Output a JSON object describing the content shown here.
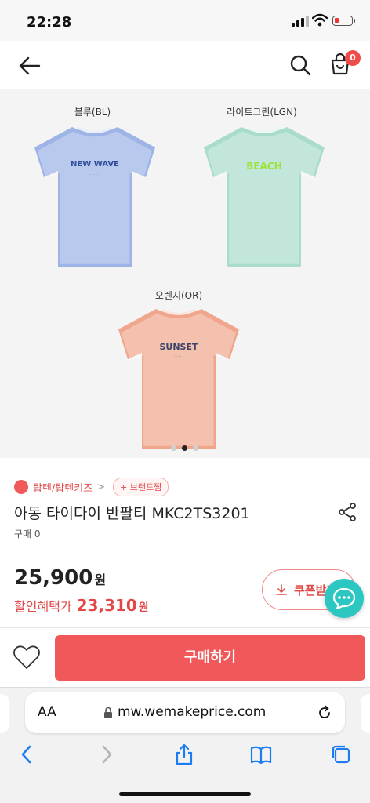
{
  "status_bar": {
    "time": "22:28",
    "signal_icon": "cellular-signal-icon",
    "wifi_icon": "wifi-icon",
    "battery_icon": "battery-low-icon",
    "battery_level": 0.15
  },
  "header": {
    "back_icon": "arrow-left-icon",
    "search_icon": "search-icon",
    "cart_icon": "shopping-bag-icon",
    "cart_count": "0"
  },
  "gallery": {
    "variants": [
      {
        "label": "블루(BL)",
        "color": "#9fb4e6",
        "print": "NEW WAVE",
        "print_color": "#2f4f9e"
      },
      {
        "label": "라이트그린(LGN)",
        "color": "#a9dccb",
        "print": "BEACH",
        "print_color": "#9be33a"
      },
      {
        "label": "오렌지(OR)",
        "color": "#f0a68c",
        "print": "SUNSET",
        "print_color": "#3b4468"
      }
    ],
    "slide_count": 3,
    "active_slide": 2
  },
  "product": {
    "brand": "탑텐/탑텐키즈",
    "brand_chevron": ">",
    "brand_like_label": "+ 브랜드찜",
    "title": "아동 타이다이 반팔티 MKC2TS3201",
    "purchase_count": "구매 0",
    "price": "25,900",
    "price_unit": "원",
    "discount_label": "할인혜택가",
    "discount_price": "23,310",
    "discount_unit": "원",
    "coupon_label": "쿠폰받기",
    "share_icon": "share-icon",
    "chat_icon": "chat-bubble-icon"
  },
  "buy_bar": {
    "wish_icon": "heart-icon",
    "buy_label": "구매하기"
  },
  "safari": {
    "aa_label": "AA",
    "url": "mw.wemakeprice.com",
    "lock_icon": "lock-icon",
    "reload_icon": "reload-icon",
    "nav_icons": [
      "back-chevron-icon",
      "forward-chevron-icon",
      "share-icon",
      "bookmarks-icon",
      "tabs-icon"
    ]
  },
  "colors": {
    "accent_red": "#f0585a",
    "teal": "#2cc7c1",
    "ios_blue": "#1e7cf2"
  }
}
